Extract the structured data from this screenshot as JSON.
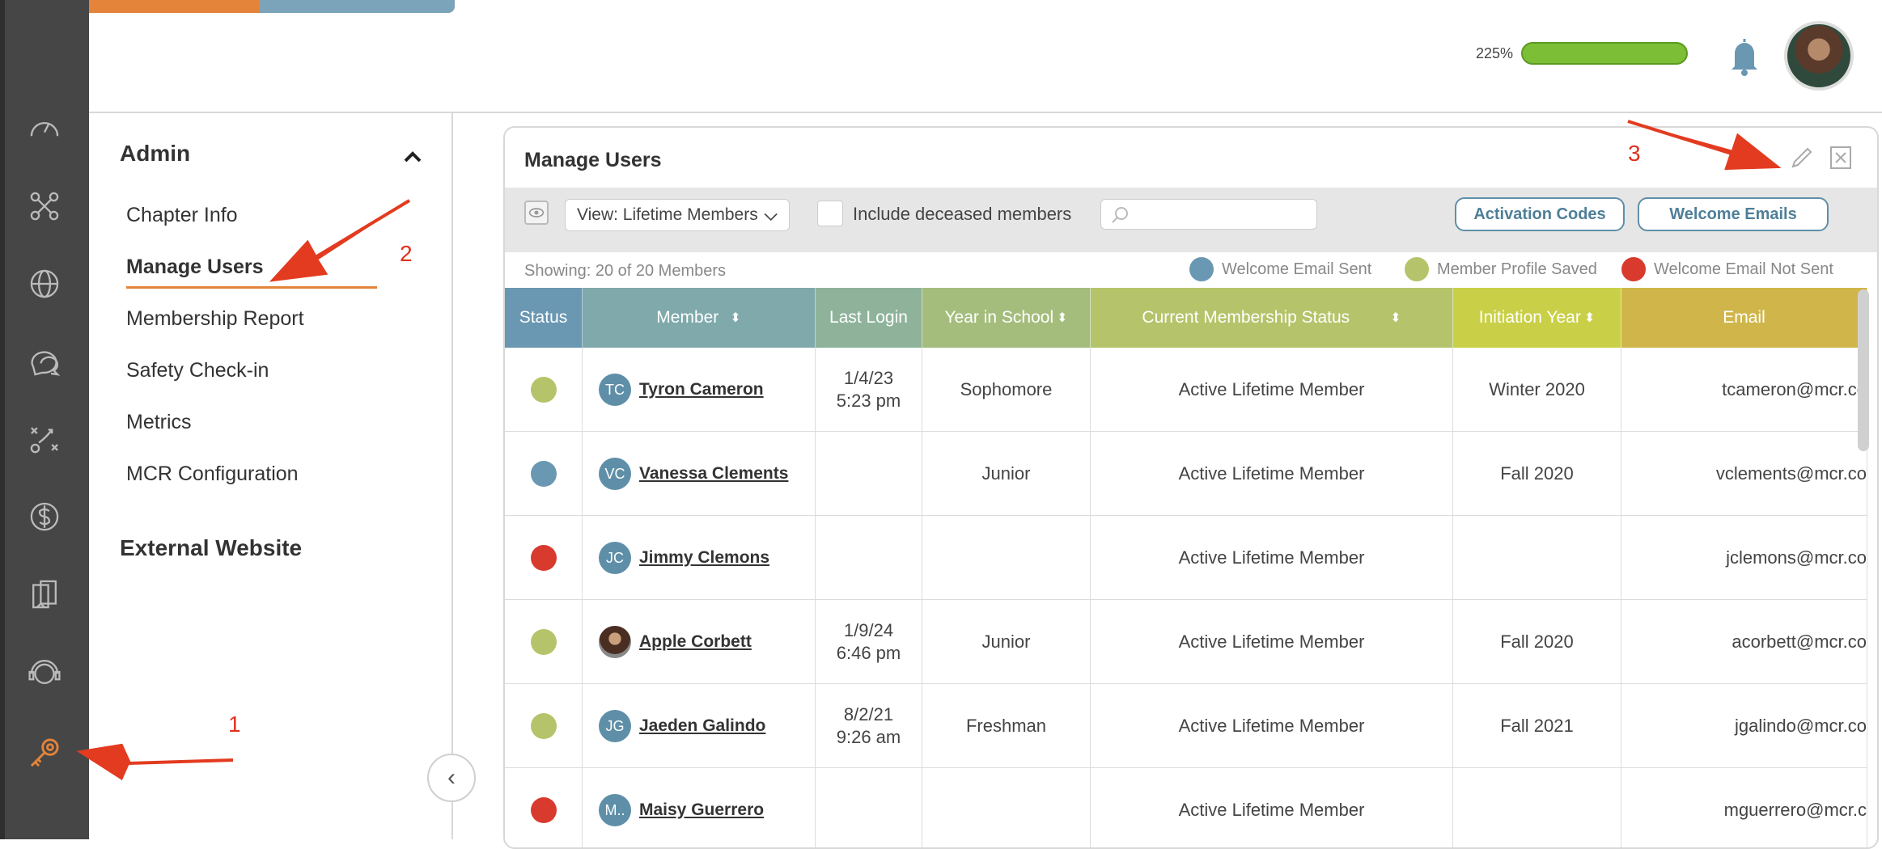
{
  "topbar": {
    "progress_pct": "225%",
    "progress_fraction": 1.0
  },
  "sidebar": {
    "section_admin": "Admin",
    "items": [
      {
        "label": "Chapter Info"
      },
      {
        "label": "Manage Users"
      },
      {
        "label": "Membership Report"
      },
      {
        "label": "Safety Check-in"
      },
      {
        "label": "Metrics"
      },
      {
        "label": "MCR Configuration"
      }
    ],
    "section_external": "External Website"
  },
  "panel": {
    "title": "Manage Users",
    "view_select": "View: Lifetime Members",
    "include_deceased_label": "Include deceased members",
    "search_placeholder": "",
    "activation_codes_label": "Activation Codes",
    "welcome_emails_label": "Welcome Emails",
    "showing": "Showing: 20 of 20 Members",
    "legend": [
      {
        "label": "Welcome Email Sent",
        "color": "#6a97b2"
      },
      {
        "label": "Member Profile Saved",
        "color": "#b5c46a"
      },
      {
        "label": "Welcome Email Not Sent",
        "color": "#d93a2e"
      }
    ]
  },
  "table": {
    "headers": [
      "Status",
      "Member",
      "Last Login",
      "Year in School",
      "Current Membership Status",
      "Initiation Year",
      "Email"
    ],
    "header_colors": [
      "#6a97b2",
      "#7fa9ab",
      "#8fb39a",
      "#a4bd7c",
      "#b5c46a",
      "#c9d048",
      "#d0b64a"
    ],
    "rows": [
      {
        "status_color": "#b5c46a",
        "initials": "TC",
        "name": "Tyron Cameron",
        "login_date": "1/4/23",
        "login_time": "5:23 pm",
        "year": "Sophomore",
        "membership": "Active Lifetime Member",
        "initiation": "Winter 2020",
        "email": "tcameron@mcr.co"
      },
      {
        "status_color": "#6a97b2",
        "initials": "VC",
        "name": "Vanessa Clements",
        "login_date": "",
        "login_time": "",
        "year": "Junior",
        "membership": "Active Lifetime Member",
        "initiation": "Fall 2020",
        "email": "vclements@mcr.co"
      },
      {
        "status_color": "#d93a2e",
        "initials": "JC",
        "name": "Jimmy Clemons",
        "login_date": "",
        "login_time": "",
        "year": "",
        "membership": "Active Lifetime Member",
        "initiation": "",
        "email": "jclemons@mcr.co"
      },
      {
        "status_color": "#b5c46a",
        "initials": "",
        "name": "Apple Corbett",
        "login_date": "1/9/24",
        "login_time": "6:46 pm",
        "year": "Junior",
        "membership": "Active Lifetime Member",
        "initiation": "Fall 2020",
        "email": "acorbett@mcr.co"
      },
      {
        "status_color": "#b5c46a",
        "initials": "JG",
        "name": "Jaeden Galindo",
        "login_date": "8/2/21",
        "login_time": "9:26 am",
        "year": "Freshman",
        "membership": "Active Lifetime Member",
        "initiation": "Fall 2021",
        "email": "jgalindo@mcr.co"
      },
      {
        "status_color": "#d93a2e",
        "initials": "M..",
        "name": "Maisy Guerrero",
        "login_date": "",
        "login_time": "",
        "year": "",
        "membership": "Active Lifetime Member",
        "initiation": "",
        "email": "mguerrero@mcr.c"
      }
    ]
  },
  "annotations": [
    "1",
    "2",
    "3"
  ],
  "colors": {
    "accent_orange": "#e4843a",
    "accent_blue": "#5f8fa8",
    "rail": "#464646",
    "annotation_red": "#e0301e"
  }
}
